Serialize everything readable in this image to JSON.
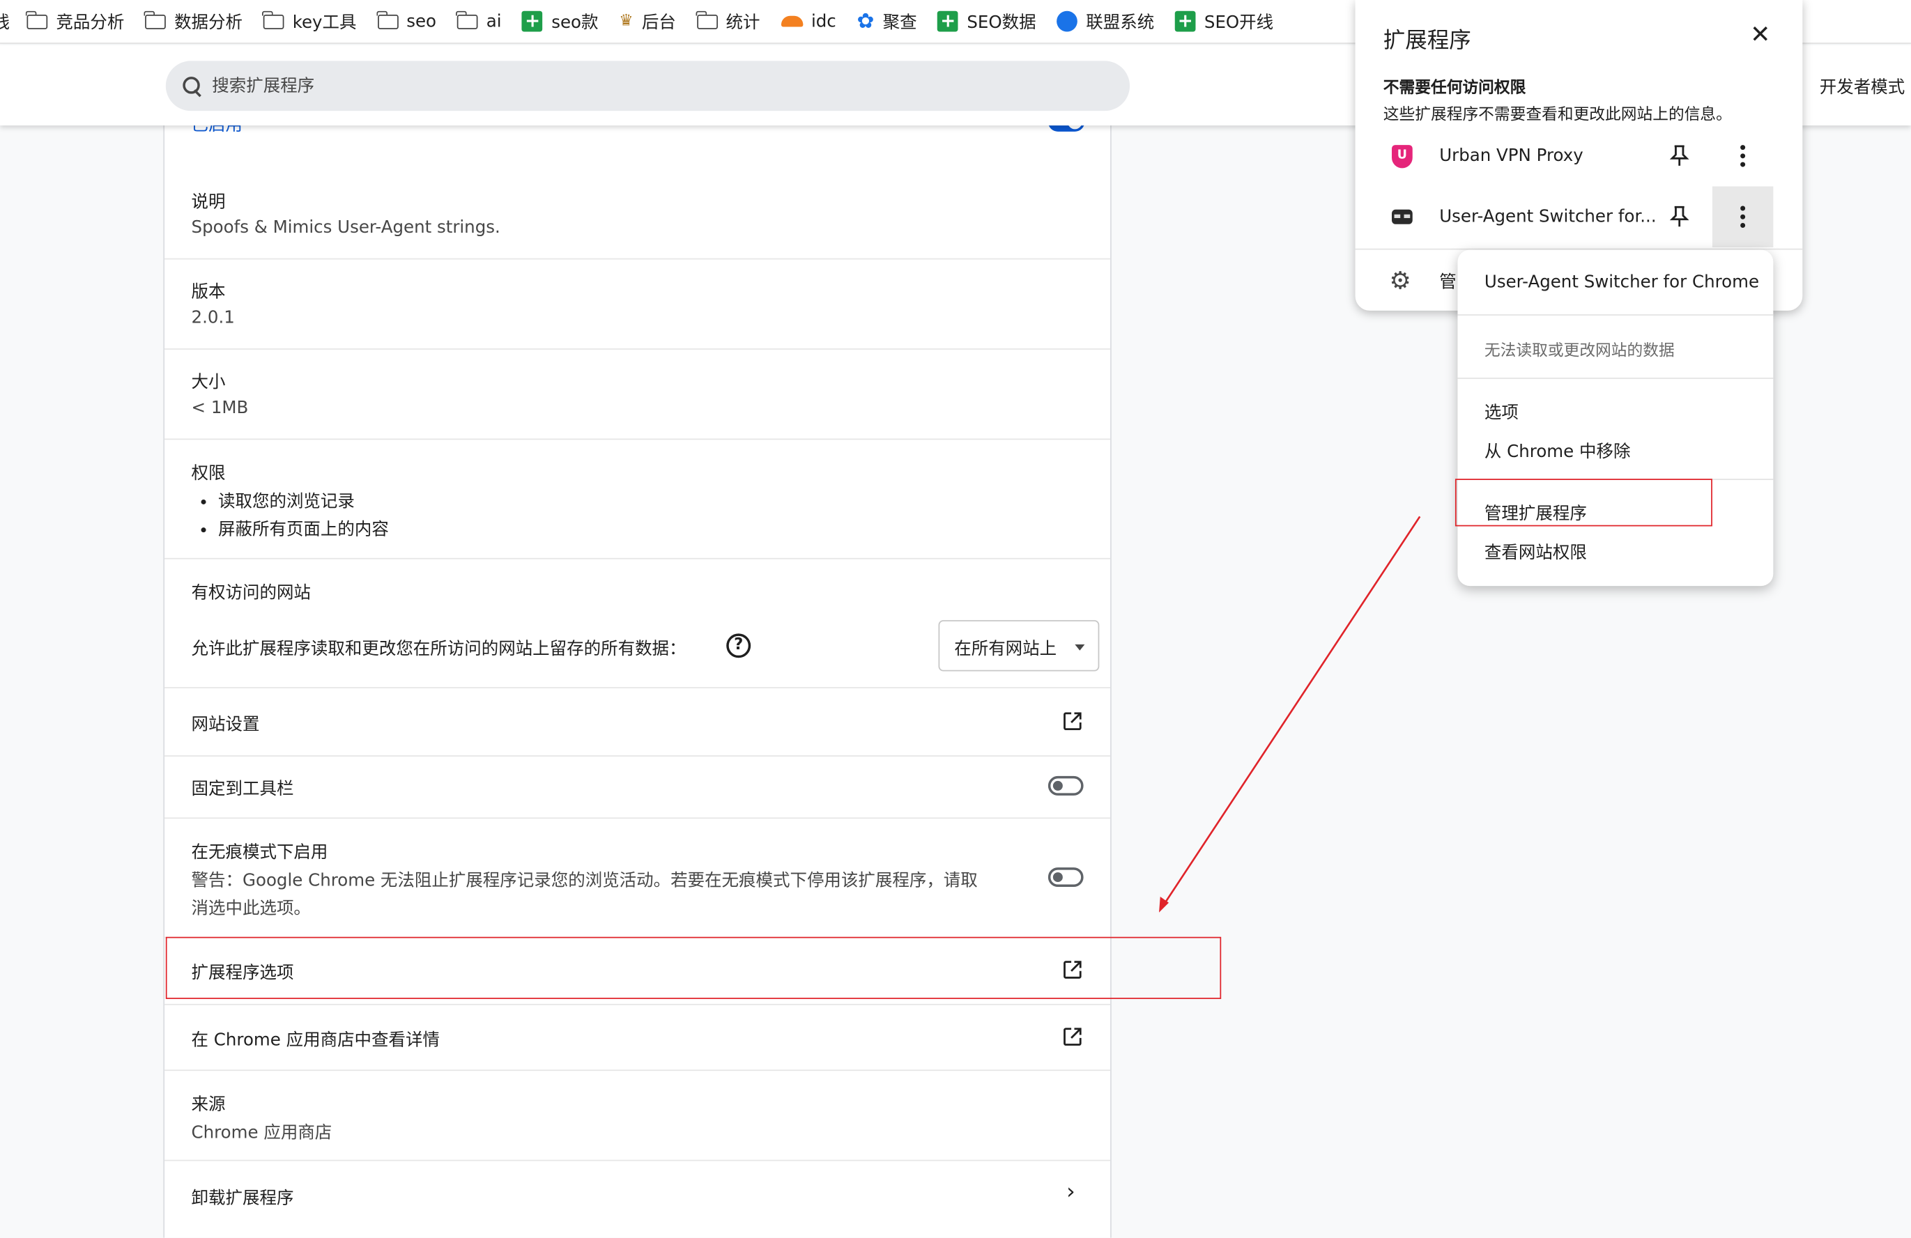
{
  "bookmarks": [
    {
      "label": "竞品分析",
      "icon": "folder-icon"
    },
    {
      "label": "数据分析",
      "icon": "folder-icon"
    },
    {
      "label": "key工具",
      "icon": "folder-icon"
    },
    {
      "label": "seo",
      "icon": "folder-icon"
    },
    {
      "label": "ai",
      "icon": "folder-icon"
    },
    {
      "label": "seo款",
      "icon": "green-plus-icon"
    },
    {
      "label": "后台",
      "icon": "crown-icon"
    },
    {
      "label": "统计",
      "icon": "folder-icon"
    },
    {
      "label": "idc",
      "icon": "cloud-icon"
    },
    {
      "label": "聚查",
      "icon": "gear-badge-icon"
    },
    {
      "label": "SEO数据",
      "icon": "green-plus-icon"
    },
    {
      "label": "联盟系统",
      "icon": "globe-icon"
    },
    {
      "label": "SEO开线",
      "icon": "green-plus-icon"
    }
  ],
  "bookmarks_leading_fragment": "线",
  "header": {
    "search_placeholder": "搜索扩展程序",
    "dev_mode_label": "开发者模式"
  },
  "details": {
    "enabled_label": "已启用",
    "description_title": "说明",
    "description_value": "Spoofs & Mimics User-Agent strings.",
    "version_title": "版本",
    "version_value": "2.0.1",
    "size_title": "大小",
    "size_value": "< 1MB",
    "permissions_title": "权限",
    "permissions": [
      "读取您的浏览记录",
      "屏蔽所有页面上的内容"
    ],
    "site_access_title": "有权访问的网站",
    "site_access_desc": "允许此扩展程序读取和更改您在所访问的网站上留存的所有数据：",
    "site_access_select": "在所有网站上",
    "site_settings": "网站设置",
    "pin_to_toolbar": "固定到工具栏",
    "incognito_title": "在无痕模式下启用",
    "incognito_warning_line1": "警告：Google Chrome 无法阻止扩展程序记录您的浏览活动。若要在无痕模式下停用该扩展程序，请取",
    "incognito_warning_line2": "消选中此选项。",
    "extension_options": "扩展程序选项",
    "view_in_store": "在 Chrome 应用商店中查看详情",
    "source_title": "来源",
    "source_value": "Chrome 应用商店",
    "uninstall": "卸载扩展程序"
  },
  "popup": {
    "title": "扩展程序",
    "section_title": "不需要任何访问权限",
    "section_desc": "这些扩展程序不需要查看和更改此网站上的信息。",
    "items": [
      {
        "name": "Urban VPN Proxy",
        "icon": "urban-vpn-icon"
      },
      {
        "name": "User-Agent Switcher for...",
        "icon": "user-agent-mask-icon"
      }
    ],
    "manage_label": "管"
  },
  "context_menu": {
    "header": "User-Agent Switcher for Chrome",
    "no_access": "无法读取或更改网站的数据",
    "options": "选项",
    "remove": "从 Chrome 中移除",
    "manage": "管理扩展程序",
    "site_permissions": "查看网站权限"
  },
  "colors": {
    "accent": "#0b57d0",
    "annotation_red": "#e0242a"
  }
}
